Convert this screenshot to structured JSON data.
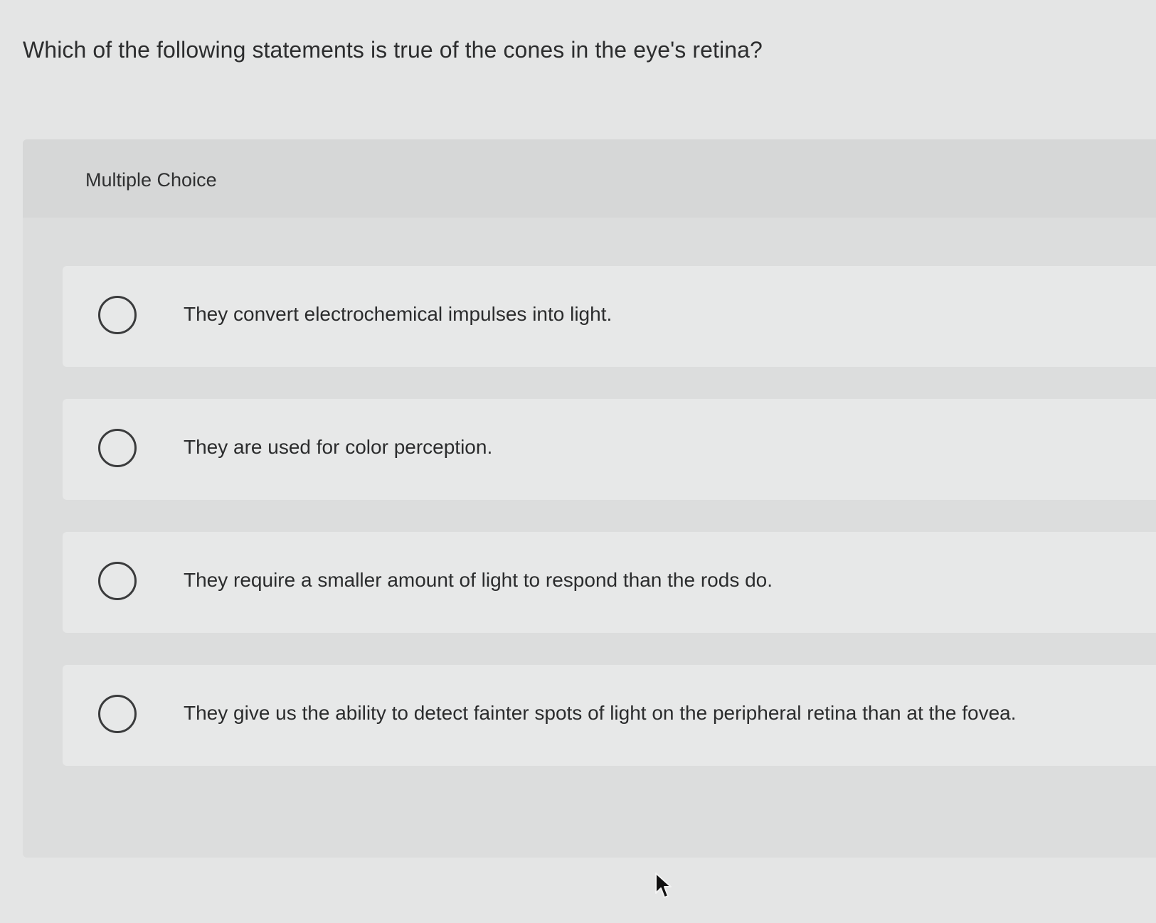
{
  "question": {
    "text": "Which of the following statements is true of the cones in the eye's retina?"
  },
  "panel": {
    "label": "Multiple Choice"
  },
  "choices": [
    {
      "text": "They convert electrochemical impulses into light."
    },
    {
      "text": "They are used for color perception."
    },
    {
      "text": "They require a smaller amount of light to respond than the rods do."
    },
    {
      "text": "They give us the ability to detect fainter spots of light on the peripheral retina than at the fovea."
    }
  ],
  "icons": {
    "radio": "radio-unselected-icon",
    "cursor": "mouse-pointer-icon"
  }
}
